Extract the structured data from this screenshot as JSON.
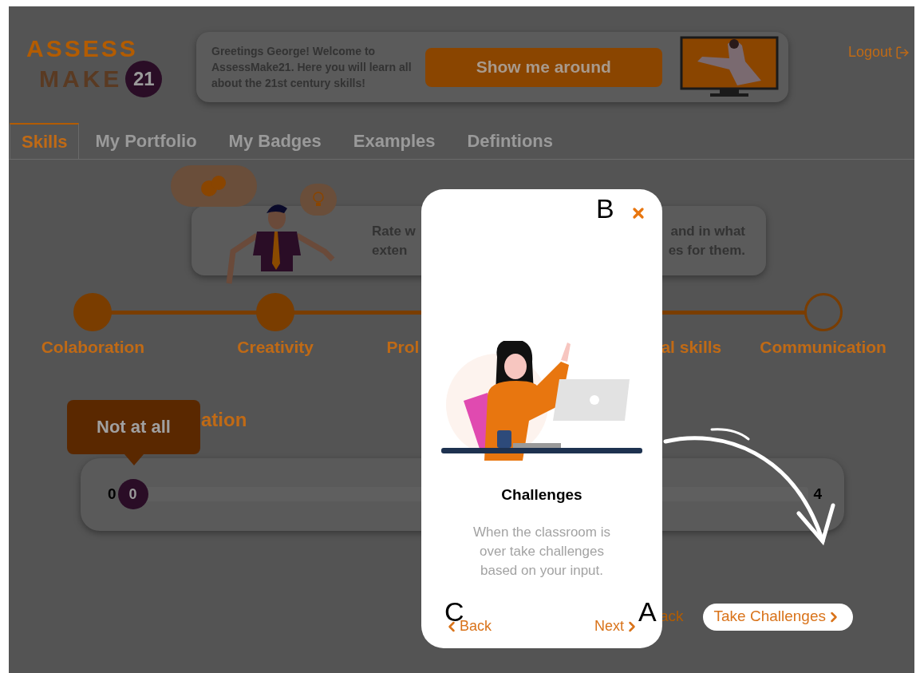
{
  "header": {
    "logo": {
      "line_1": "ASSESS",
      "line_2": "MAKE",
      "badge": "21"
    },
    "greeting": "Greetings George! Welcome to AssessMake21. Here you will learn all about the 21st century skills!",
    "tour_button": "Show me around",
    "logout": "Logout"
  },
  "tabs": [
    {
      "label": "Skills",
      "selected": true
    },
    {
      "label": "My Portfolio",
      "selected": false
    },
    {
      "label": "My Badges",
      "selected": false
    },
    {
      "label": "Examples",
      "selected": false
    },
    {
      "label": "Defintions",
      "selected": false
    }
  ],
  "intro": {
    "left_fragment": "Rate w exten",
    "right_fragment": "and in what es for them."
  },
  "steps": [
    {
      "label": "Colaboration",
      "done": true
    },
    {
      "label": "Creativity",
      "done": true
    },
    {
      "label": "Prol"
    },
    {
      "label": "al skills"
    },
    {
      "label": "Communication",
      "done": false
    }
  ],
  "section_heading": "ation",
  "slider": {
    "tooltip": "Not at all",
    "min_label": "0",
    "value": "0",
    "max_label": "4",
    "level": 0
  },
  "back_link": "ack",
  "take_challenges": "Take Challenges",
  "modal": {
    "title": "Challenges",
    "description": "When the classroom is over take challenges based on your input.",
    "back": "Back",
    "next": "Next"
  },
  "annotations": [
    {
      "label": "B"
    },
    {
      "label": "C"
    },
    {
      "label": "A"
    }
  ]
}
